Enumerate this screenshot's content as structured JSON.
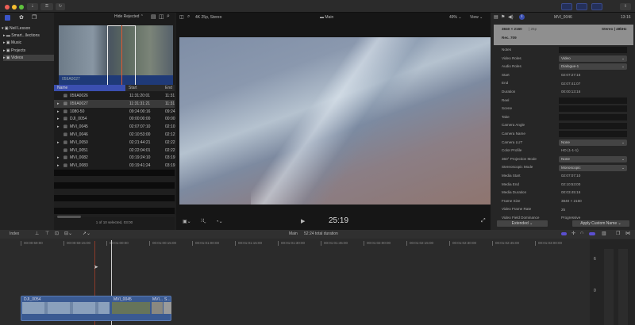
{
  "titlebar": {
    "lights": [
      "#ee5f57",
      "#f5bd30",
      "#5fc33e"
    ],
    "download_icon": "download-icon",
    "key_icon": "key-icon",
    "sync_icon": "sync-icon",
    "share_icon": "share-icon"
  },
  "sidebar": {
    "library": "Neil Lesson",
    "items": [
      {
        "label": "Smart...llections",
        "icon": "folder-icon"
      },
      {
        "label": "Music",
        "icon": "event-icon"
      },
      {
        "label": "Projects",
        "icon": "event-icon"
      },
      {
        "label": "Videos",
        "icon": "event-icon",
        "selected": true
      }
    ]
  },
  "browser": {
    "filter": "Hide Rejected",
    "filmstrip_label": "059A0027",
    "columns": [
      "Name",
      "Start",
      "End"
    ],
    "rows": [
      {
        "name": "059A0026",
        "start": "11:31:20:01",
        "end": "11:31",
        "expandable": false
      },
      {
        "name": "059A0027",
        "start": "11:31:31:21",
        "end": "11:31",
        "expandable": true,
        "selected": true
      },
      {
        "name": "1080-50",
        "start": "09:24:00:16",
        "end": "09:24",
        "expandable": true
      },
      {
        "name": "DJI_0054",
        "start": "00:00:00:00",
        "end": "00:00",
        "expandable": true
      },
      {
        "name": "MVI_0045",
        "start": "02:07:07:10",
        "end": "02:10",
        "expandable": true
      },
      {
        "name": "MVI_0046",
        "start": "02:10:53:00",
        "end": "02:12",
        "expandable": false
      },
      {
        "name": "MVI_0050",
        "start": "02:21:44:21",
        "end": "02:22",
        "expandable": true
      },
      {
        "name": "MVI_0051",
        "start": "02:22:04:01",
        "end": "02:22",
        "expandable": false
      },
      {
        "name": "MVI_0082",
        "start": "03:19:24:10",
        "end": "03:19",
        "expandable": true
      },
      {
        "name": "MVI_0083",
        "start": "03:19:41:24",
        "end": "03:19",
        "expandable": true
      }
    ],
    "status": "1 of 10 selected, 03:00"
  },
  "viewer": {
    "format": "4K 25p, Stereo",
    "project": "Main",
    "zoom": "49%",
    "view_menu": "View",
    "timecode": "25:19"
  },
  "inspector": {
    "clip_name": "MVI_0046",
    "duration": "13:16",
    "resolution": "3840 × 2160",
    "fps": "| 25p",
    "audio": "Stereo | 48kHz",
    "color_space": "Rec. 709",
    "rows": [
      {
        "label": "Notes",
        "value": "",
        "type": "box"
      },
      {
        "label": "Video Roles",
        "value": "Video",
        "type": "select"
      },
      {
        "label": "Audio Roles",
        "value": "Dialogue-1",
        "type": "select"
      },
      {
        "label": "Start",
        "value": "02:07:27:16",
        "type": "text"
      },
      {
        "label": "End",
        "value": "02:07:41:07",
        "type": "text"
      },
      {
        "label": "Duration",
        "value": "00:00:13:16",
        "type": "text"
      },
      {
        "label": "Reel",
        "value": "",
        "type": "box"
      },
      {
        "label": "Scene",
        "value": "",
        "type": "box"
      },
      {
        "label": "Take",
        "value": "",
        "type": "box"
      },
      {
        "label": "Camera Angle",
        "value": "",
        "type": "box"
      },
      {
        "label": "Camera Name",
        "value": "",
        "type": "box"
      },
      {
        "label": "Camera LUT",
        "value": "None",
        "type": "select"
      },
      {
        "label": "Color Profile",
        "value": "HD (1-1-1)",
        "type": "text"
      },
      {
        "label": "360° Projection Mode",
        "value": "None",
        "type": "select"
      },
      {
        "label": "Stereoscopic Mode",
        "value": "Monoscopic",
        "type": "select"
      },
      {
        "label": "Media Start",
        "value": "02:07:07:10",
        "type": "text"
      },
      {
        "label": "Media End",
        "value": "02:10:53:00",
        "type": "text"
      },
      {
        "label": "Media Duration",
        "value": "00:03:45:16",
        "type": "text"
      },
      {
        "label": "Frame Size",
        "value": "3840 × 2160",
        "type": "text"
      },
      {
        "label": "Video Frame Rate",
        "value": "25",
        "type": "text"
      },
      {
        "label": "Video Field Dominance",
        "value": "Progressive",
        "type": "text"
      }
    ],
    "metadata_view": "Extended",
    "apply_button": "Apply Custom Name"
  },
  "timeline": {
    "index_label": "Index",
    "project": "Main",
    "duration": "52:24 total duration",
    "ruler": [
      "00:00:59:00",
      "00:00:59:15:00",
      "00:01:00:00",
      "00:01:00:15:00",
      "00:01:01:00:00",
      "00:01:01:15:00",
      "00:01:01:30:00",
      "00:01:01:45:00",
      "00:01:02:00:00",
      "00:01:02:15:00",
      "00:01:02:30:00",
      "00:01:02:45:00",
      "00:01:03:00:00"
    ],
    "clips": [
      {
        "name": "DJI_0054"
      },
      {
        "name": "MVI_0045"
      },
      {
        "name": "MVI..."
      },
      {
        "name": "S..."
      }
    ],
    "meter_labels": [
      "6",
      "0"
    ]
  }
}
